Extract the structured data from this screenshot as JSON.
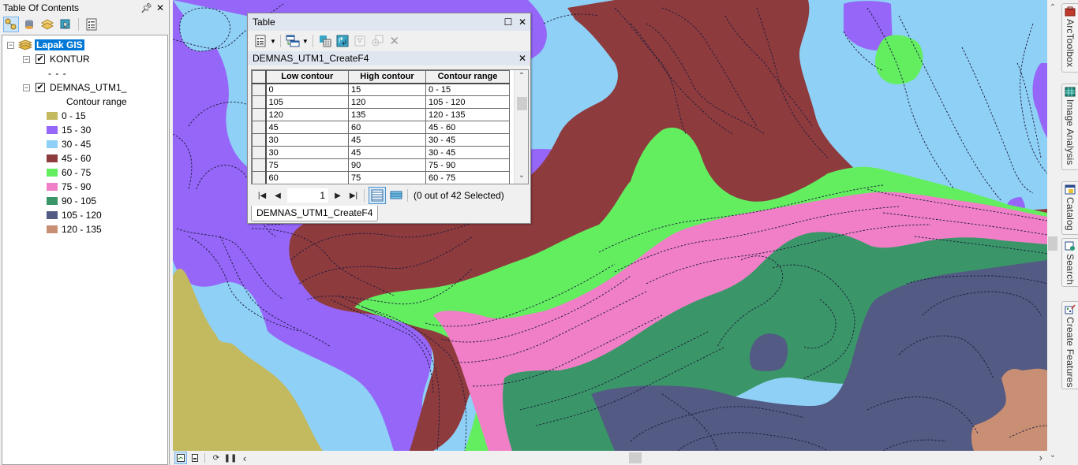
{
  "toc": {
    "title": "Table Of Contents",
    "pin_icon": "pin-icon",
    "close_icon": "close-icon",
    "toolbar": [
      "list-by-drawing-order-icon",
      "list-by-source-icon",
      "list-by-visibility-icon",
      "list-by-selection-icon",
      "options-icon"
    ],
    "dataframe": "Lapak GIS",
    "layers": [
      {
        "name": "KONTUR",
        "checked": true,
        "symbol": "- - -"
      },
      {
        "name": "DEMNAS_UTM1_",
        "checked": true,
        "field": "Contour range",
        "classes": [
          {
            "label": "0 - 15",
            "color": "#c3b95e"
          },
          {
            "label": "15 - 30",
            "color": "#9566f7"
          },
          {
            "label": "30 - 45",
            "color": "#8fd0f6"
          },
          {
            "label": "45 - 60",
            "color": "#8e3b3e"
          },
          {
            "label": "60 - 75",
            "color": "#63ee60"
          },
          {
            "label": "75 - 90",
            "color": "#f07fc8"
          },
          {
            "label": "90 - 105",
            "color": "#3a9668"
          },
          {
            "label": "105 - 120",
            "color": "#535a83"
          },
          {
            "label": "120 - 135",
            "color": "#c98f74"
          }
        ]
      }
    ]
  },
  "table_window": {
    "title": "Table",
    "toolbar": [
      "table-options-icon",
      "related-tables-icon",
      "select-by-attributes-icon",
      "switch-selection-icon",
      "clear-selection-icon",
      "zoom-to-selected-icon",
      "delete-selected-icon"
    ],
    "layer_title": "DEMNAS_UTM1_CreateF4",
    "columns": [
      "Low contour",
      "High contour",
      "Contour range"
    ],
    "rows": [
      [
        "0",
        "15",
        "0 - 15"
      ],
      [
        "105",
        "120",
        "105 - 120"
      ],
      [
        "120",
        "135",
        "120 - 135"
      ],
      [
        "45",
        "60",
        "45 - 60"
      ],
      [
        "30",
        "45",
        "30 - 45"
      ],
      [
        "30",
        "45",
        "30 - 45"
      ],
      [
        "75",
        "90",
        "75 - 90"
      ],
      [
        "60",
        "75",
        "60 - 75"
      ]
    ],
    "current_record": "1",
    "selection_status": "(0 out of 42 Selected)",
    "tab_label": "DEMNAS_UTM1_CreateF4"
  },
  "dock_tabs": [
    {
      "label": "ArcToolbox",
      "icon": "toolbox-icon"
    },
    {
      "label": "Image Analysis",
      "icon": "image-analysis-icon"
    },
    {
      "label": "Catalog",
      "icon": "catalog-icon"
    },
    {
      "label": "Search",
      "icon": "search-icon"
    },
    {
      "label": "Create Features",
      "icon": "create-features-icon"
    }
  ],
  "map_bar": [
    "data-view-icon",
    "layout-view-icon",
    "refresh-icon",
    "pause-drawing-icon",
    "scroll-left-icon"
  ]
}
